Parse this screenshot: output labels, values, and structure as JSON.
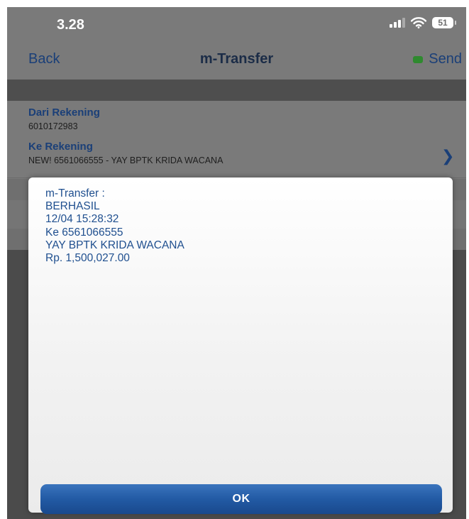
{
  "status_bar": {
    "time": "3.28",
    "battery": "51"
  },
  "nav": {
    "back_label": "Back",
    "title": "m-Transfer",
    "send_label": "Send"
  },
  "form": {
    "from_label": "Dari Rekening",
    "from_value": "6010172983",
    "to_label": "Ke Rekening",
    "to_value": "NEW! 6561066555 - YAY BPTK KRIDA WACANA"
  },
  "dialog": {
    "lines": [
      "m-Transfer :",
      "BERHASIL",
      "12/04 15:28:32",
      "Ke 6561066555",
      "YAY BPTK KRIDA WACANA",
      "Rp. 1,500,027.00"
    ],
    "ok_label": "OK"
  },
  "icons": {
    "signal": "signal-icon",
    "wifi": "wifi-icon",
    "battery": "battery-icon",
    "chevron": "chevron-right-icon"
  },
  "colors": {
    "accent": "#1a3f78",
    "dialog_text": "#1f4f8f",
    "ok_button": "#225aa4",
    "send_indicator": "#2f8a2f"
  }
}
